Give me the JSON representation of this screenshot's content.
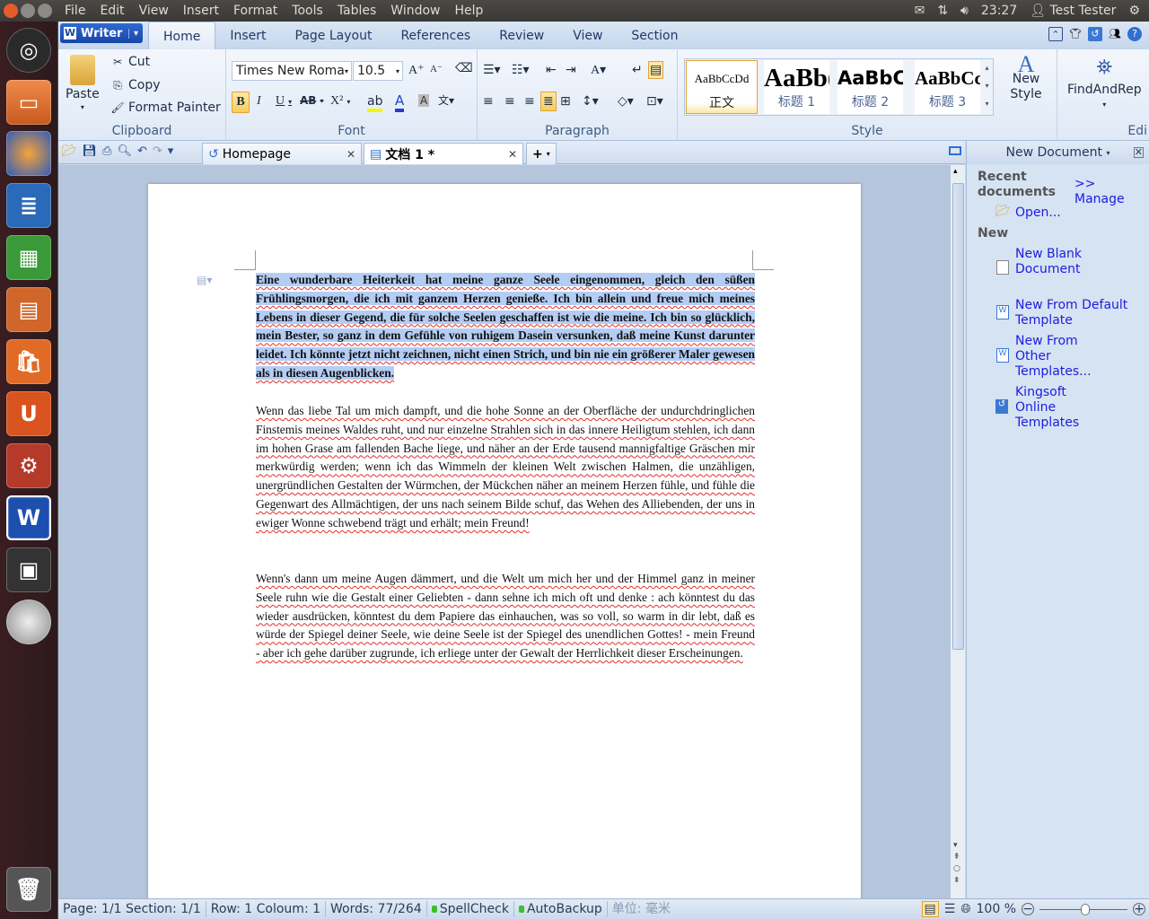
{
  "top_panel": {
    "menus": [
      "File",
      "Edit",
      "View",
      "Insert",
      "Format",
      "Tools",
      "Tables",
      "Window",
      "Help"
    ],
    "time": "23:27",
    "user": "Test Tester"
  },
  "launcher": {
    "items": [
      "ubuntu-dash",
      "files",
      "firefox",
      "writer-doc",
      "spreadsheet",
      "presentation",
      "software-center",
      "ubuntu-one",
      "system-settings",
      "kingsoft-writer",
      "workspaces",
      "dvd"
    ],
    "trash": "trash"
  },
  "app": {
    "writer_label": "Writer",
    "tabs": [
      "Home",
      "Insert",
      "Page Layout",
      "References",
      "Review",
      "View",
      "Section"
    ],
    "active_tab": "Home"
  },
  "ribbon": {
    "clipboard": {
      "paste": "Paste",
      "cut": "Cut",
      "copy": "Copy",
      "format_painter": "Format Painter",
      "label": "Clipboard"
    },
    "font": {
      "name": "Times New Roma",
      "size": "10.5",
      "label": "Font",
      "bold": "B",
      "italic": "I",
      "underline": "U",
      "strike": "AB",
      "super": "X²"
    },
    "paragraph": {
      "label": "Paragraph"
    },
    "style": {
      "label": "Style",
      "items": [
        {
          "preview": "AaBbCcDd",
          "name": "正文"
        },
        {
          "preview": "AaBb(",
          "name": "标题 1"
        },
        {
          "preview": "AaBbCc",
          "name": "标题 2"
        },
        {
          "preview": "AaBbCc",
          "name": "标题 3"
        }
      ],
      "new_style": "New Style"
    },
    "edit": {
      "find": "FindAndRep",
      "label": "Edi"
    }
  },
  "doc_tabs": [
    {
      "label": "Homepage"
    },
    {
      "label": "文档 1 *"
    }
  ],
  "document": {
    "paragraphs": [
      "Eine wunderbare Heiterkeit hat meine ganze Seele eingenommen, gleich den süßen Frühlingsmorgen, die ich mit ganzem Herzen genieße. Ich bin allein und freue mich meines Lebens in dieser Gegend, die für solche Seelen geschaffen ist wie die meine. Ich bin so glücklich, mein Bester, so ganz in dem Gefühle von ruhigem Dasein versunken, daß meine Kunst darunter leidet. Ich könnte jetzt nicht zeichnen, nicht einen Strich, und bin nie ein größerer Maler gewesen als in diesen Augenblicken.",
      "Wenn das liebe Tal um mich dampft, und die hohe Sonne an der Oberfläche der undurchdringlichen Finstemis meines Waldes ruht, und nur einzelne Strahlen sich in das innere Heiligtum stehlen, ich dann im hohen Grase am fallenden Bache liege, und näher an der Erde tausend mannigfaltige Gräschen mir merkwürdig werden; wenn ich das Wimmeln der kleinen Welt zwischen Halmen, die unzähligen, unergründlichen Gestalten der Würmchen, der Mückchen näher an meinem Herzen fühle, und fühle die Gegenwart des Allmächtigen, der uns nach seinem Bilde schuf, das Wehen des Alliebenden, der uns in ewiger Wonne schwebend trägt und erhält; mein Freund!",
      "Wenn's dann um meine Augen dämmert, und die Welt um mich her und der Himmel ganz in meiner Seele ruhn wie die Gestalt einer Geliebten - dann sehne ich mich oft und denke : ach könntest du das wieder ausdrücken, könntest du dem Papiere das einhauchen, was so voll, so warm in dir lebt, daß es würde der Spiegel deiner Seele, wie deine Seele ist der Spiegel des unendlichen Gottes! - mein Freund - aber ich gehe darüber zugrunde, ich erliege unter der Gewalt der Herrlichkeit dieser Erscheinungen."
    ]
  },
  "task_pane": {
    "title": "New Document",
    "recent": "Recent documents",
    "manage": ">> Manage",
    "open": "Open...",
    "new_heading": "New",
    "links": [
      "New Blank Document",
      "New From Default Template",
      "New From Other Templates...",
      "Kingsoft Online Templates"
    ]
  },
  "status": {
    "page": "Page: 1/1 Section: 1/1",
    "row": "Row: 1 Coloum: 1",
    "words": "Words: 77/264",
    "spell": "SpellCheck",
    "backup": "AutoBackup",
    "unit": "单位: 毫米",
    "zoom": "100 %",
    "zoom_level": 100
  }
}
